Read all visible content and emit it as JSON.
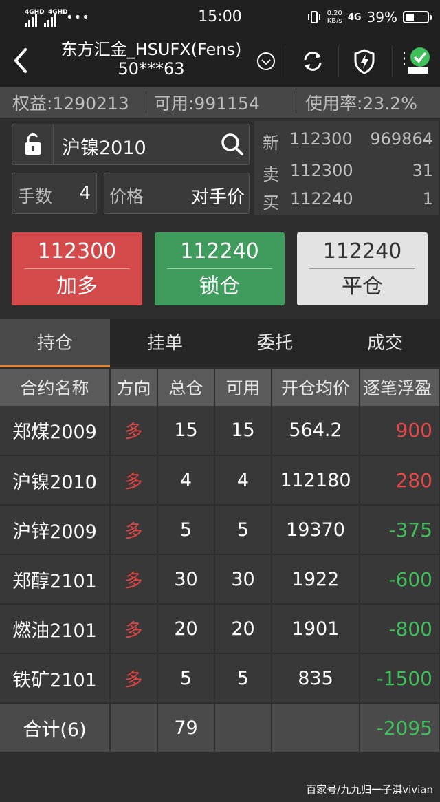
{
  "status": {
    "net1": "4GHD",
    "net2": "4GHD",
    "dots": "•••",
    "time": "15:00",
    "speed_value": "0.20",
    "speed_unit": "KB/s",
    "net_type": "4G",
    "battery": "39%",
    "battery_level": 0.39
  },
  "header": {
    "title_line1": "东方汇金_HSUFX(Fens)",
    "title_line2": "50***63",
    "icons": [
      "back-arrow-icon",
      "chevron-down-circle-icon",
      "refresh-icon",
      "shield-lightning-icon",
      "server-connected-icon"
    ]
  },
  "account": {
    "equity": "权益:1290213",
    "available": "可用:991154",
    "usage": "使用率:23.2%"
  },
  "order": {
    "contract": "沪镍2010",
    "lots_label": "手数",
    "lots_value": "4",
    "price_label": "价格",
    "price_value": "对手价"
  },
  "quote": {
    "last_label": "新",
    "last_price": "112300",
    "last_volume": "969864",
    "ask_label": "卖",
    "ask_price": "112300",
    "ask_volume": "31",
    "bid_label": "买",
    "bid_price": "112240",
    "bid_volume": "1"
  },
  "buttons": {
    "buy": {
      "price": "112300",
      "label": "加多"
    },
    "lock": {
      "price": "112240",
      "label": "锁仓"
    },
    "close": {
      "price": "112240",
      "label": "平仓"
    }
  },
  "tabs": [
    "持仓",
    "挂单",
    "委托",
    "成交"
  ],
  "table": {
    "headers": [
      "合约名称",
      "方向",
      "总仓",
      "可用",
      "开仓均价",
      "逐笔浮盈"
    ],
    "rows": [
      [
        "郑煤2009",
        "多",
        "15",
        "15",
        "564.2",
        "900"
      ],
      [
        "沪镍2010",
        "多",
        "4",
        "4",
        "112180",
        "280"
      ],
      [
        "沪锌2009",
        "多",
        "5",
        "5",
        "19370",
        "-375"
      ],
      [
        "郑醇2101",
        "多",
        "30",
        "30",
        "1922",
        "-600"
      ],
      [
        "燃油2101",
        "多",
        "20",
        "20",
        "1901",
        "-800"
      ],
      [
        "铁矿2101",
        "多",
        "5",
        "5",
        "835",
        "-1500"
      ]
    ],
    "total": [
      "合计(6)",
      "",
      "79",
      "",
      "",
      "-2095"
    ]
  },
  "colors": {
    "buy": "#d44a4a",
    "lock": "#3f9c5c",
    "close": "#e3e3e3",
    "profit": "#e84848",
    "loss": "#3fbf5a",
    "tab_accent": "#e8832e"
  },
  "watermark": "百家号/九九归一子淇vivian"
}
